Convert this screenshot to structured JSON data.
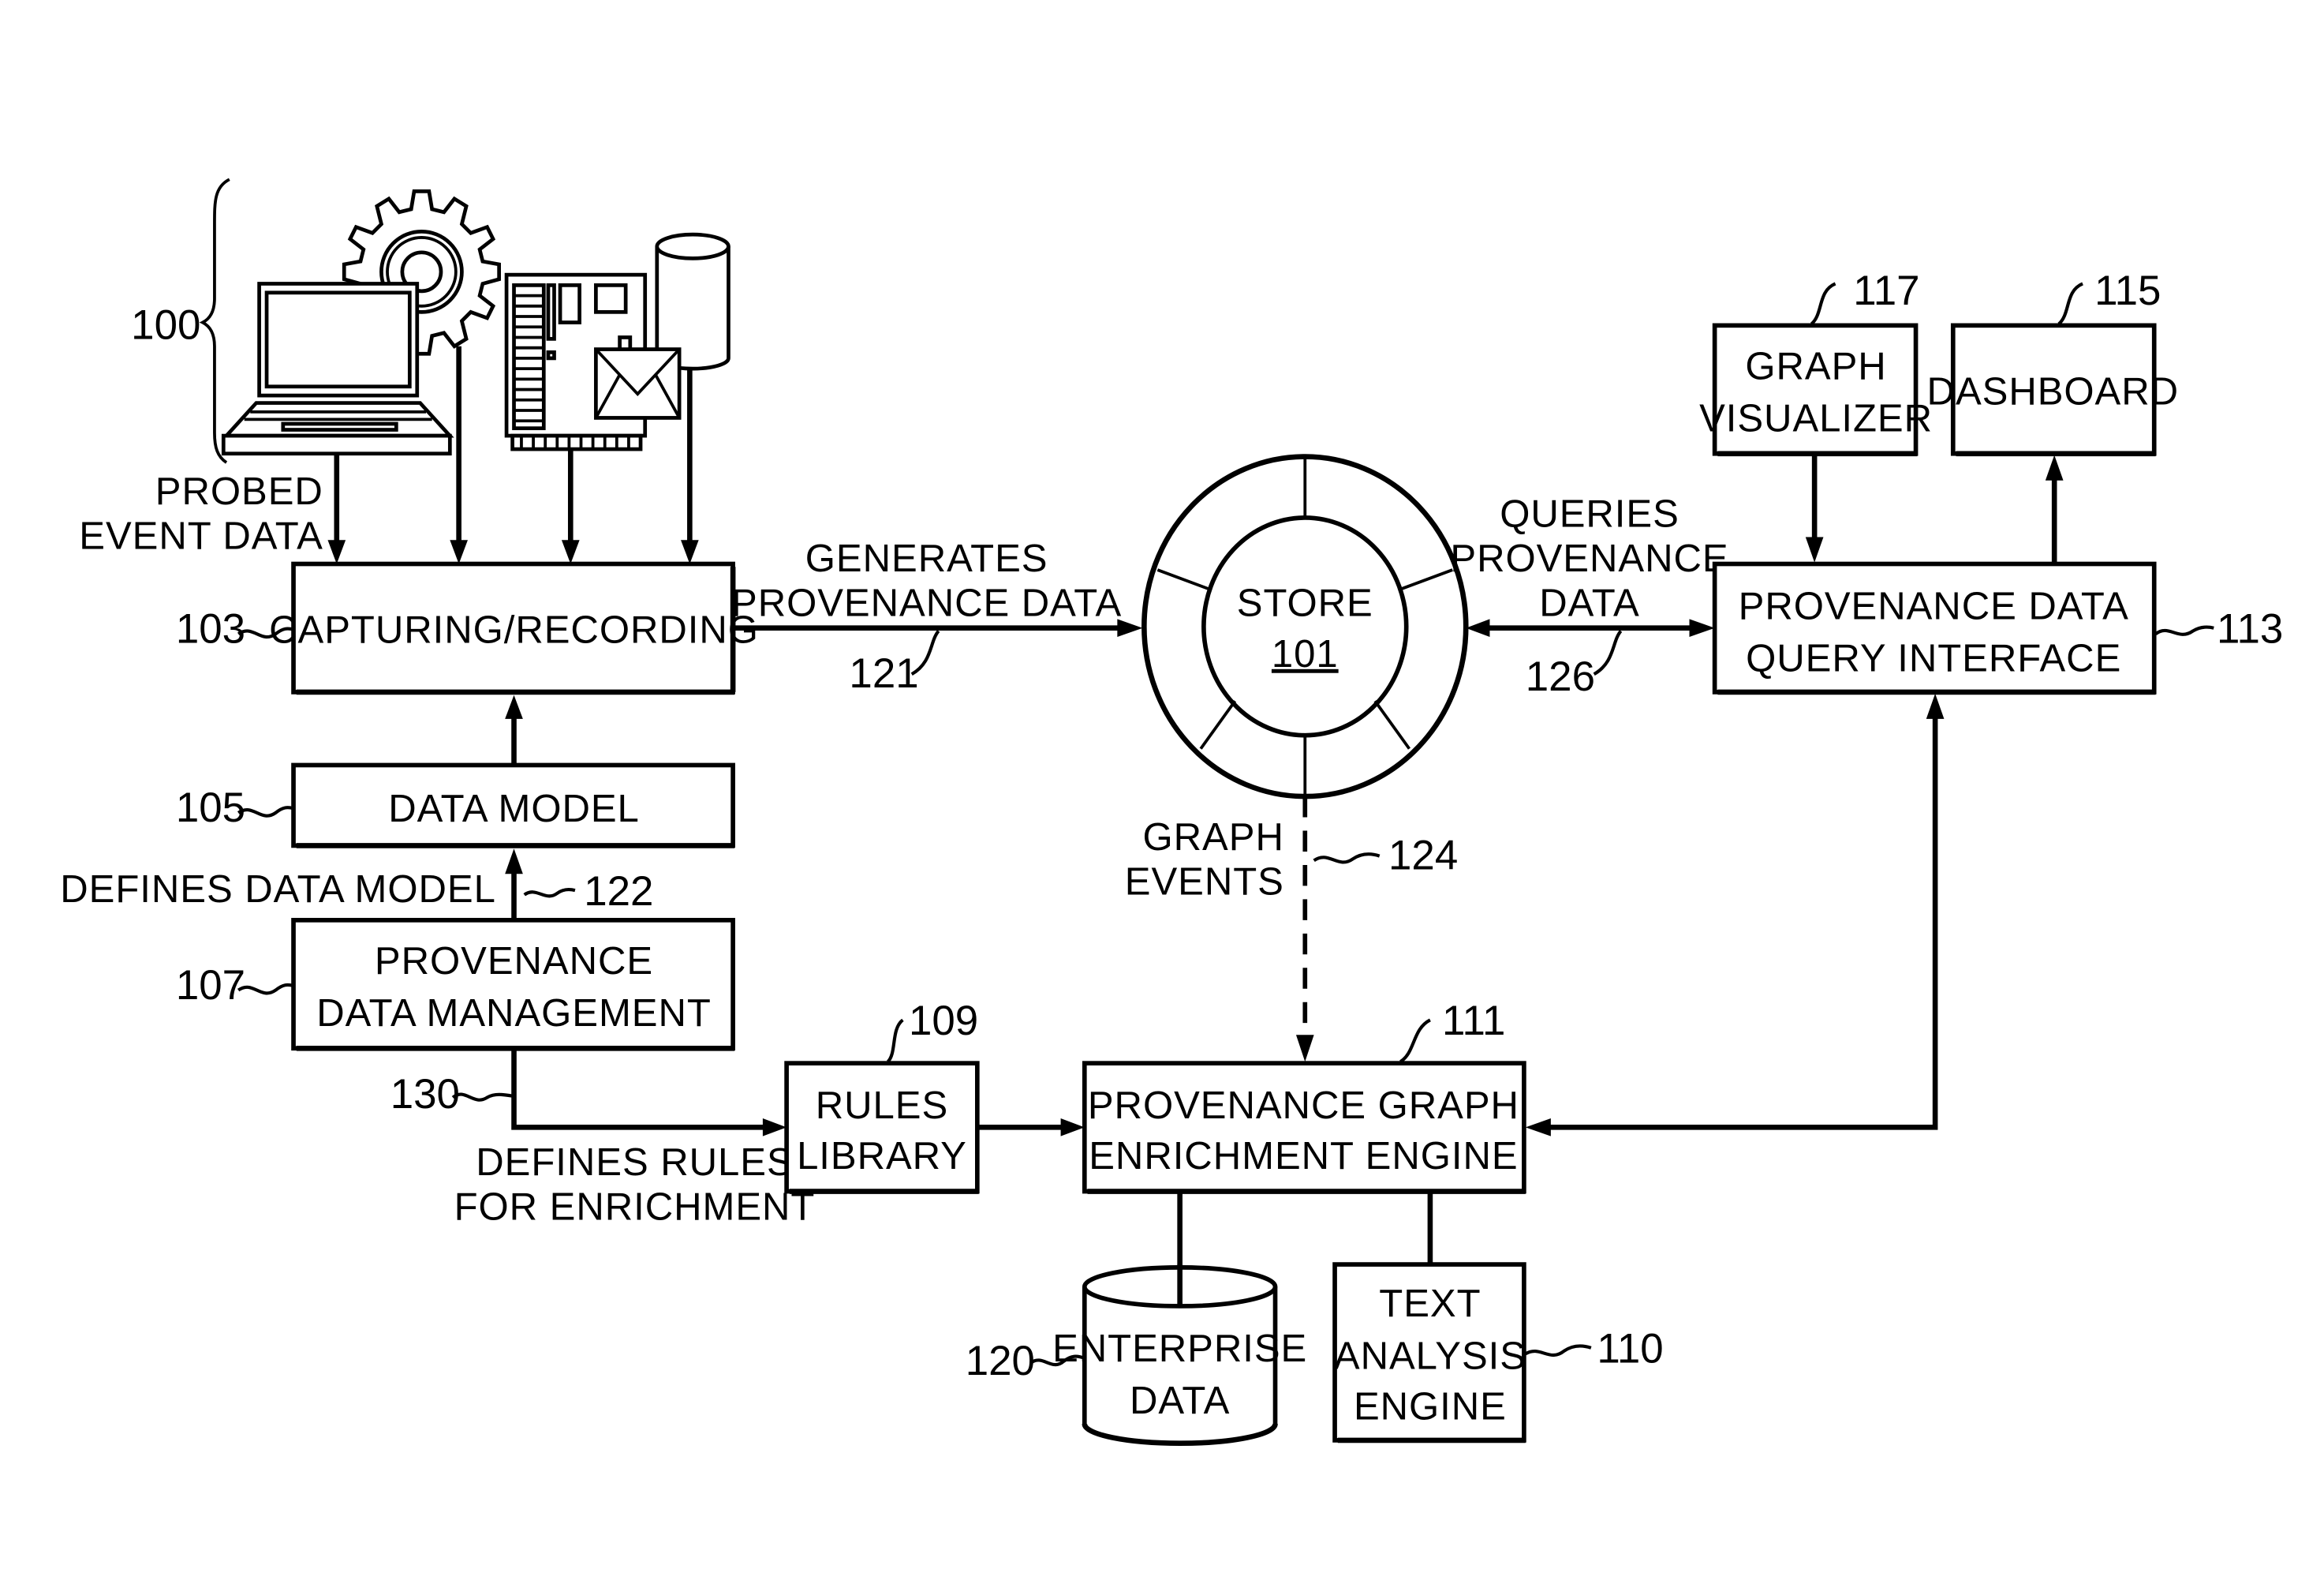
{
  "figure": {
    "source_group": {
      "ref": "100",
      "probe_label": [
        "PROBED",
        "EVENT DATA"
      ]
    },
    "blocks": {
      "capturing": {
        "ref": "103",
        "lines": [
          "CAPTURING/RECORDING"
        ]
      },
      "data_model": {
        "ref": "105",
        "lines": [
          "DATA MODEL"
        ]
      },
      "prov_mgmt": {
        "ref": "107",
        "lines": [
          "PROVENANCE",
          "DATA MANAGEMENT"
        ]
      },
      "rules_lib": {
        "ref": "109",
        "lines": [
          "RULES",
          "LIBRARY"
        ]
      },
      "enrichment": {
        "ref": "111",
        "lines": [
          "PROVENANCE GRAPH",
          "ENRICHMENT ENGINE"
        ]
      },
      "text_analysis": {
        "ref": "110",
        "lines": [
          "TEXT",
          "ANALYSIS",
          "ENGINE"
        ]
      },
      "enterprise_data": {
        "ref": "120",
        "lines": [
          "ENTERPRISE",
          "DATA"
        ]
      },
      "query_iface": {
        "ref": "113",
        "lines": [
          "PROVENANCE DATA",
          "QUERY INTERFACE"
        ]
      },
      "graph_vis": {
        "ref": "117",
        "lines": [
          "GRAPH",
          "VISUALIZER"
        ]
      },
      "dashboard": {
        "ref": "115",
        "lines": [
          "DASHBOARD"
        ]
      },
      "store": {
        "ref": "101",
        "title": "STORE"
      }
    },
    "edges": {
      "generates": {
        "ref": "121",
        "lines": [
          "GENERATES",
          "PROVENANCE DATA"
        ]
      },
      "queries": {
        "ref": "126",
        "lines": [
          "QUERIES",
          "PROVENANCE",
          "DATA"
        ]
      },
      "graph_events": {
        "ref": "124",
        "lines": [
          "GRAPH",
          "EVENTS"
        ]
      },
      "defines_model": {
        "ref": "122",
        "lines": [
          "DEFINES DATA MODEL"
        ]
      },
      "defines_rules": {
        "ref": "130",
        "lines": [
          "DEFINES RULES",
          "FOR ENRICHMENT"
        ]
      }
    },
    "icons": [
      "laptop-icon",
      "gear-icon",
      "circuit-board-icon",
      "envelope-icon",
      "database-cylinder-icon"
    ]
  }
}
